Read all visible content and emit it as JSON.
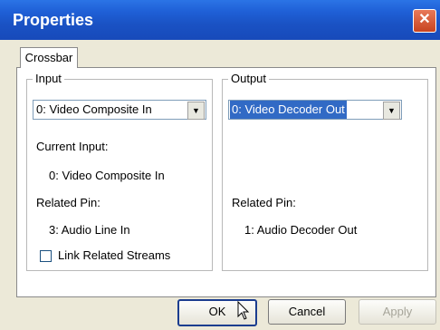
{
  "window": {
    "title": "Properties"
  },
  "tabs": [
    {
      "label": "Crossbar"
    }
  ],
  "input": {
    "group_label": "Input",
    "select_value": "0: Video Composite In",
    "current_input_label": "Current Input:",
    "current_input_value": "0: Video Composite In",
    "related_pin_label": "Related Pin:",
    "related_pin_value": "3: Audio Line In",
    "link_label": "Link Related Streams",
    "link_checked": false
  },
  "output": {
    "group_label": "Output",
    "select_value": "0: Video Decoder Out",
    "related_pin_label": "Related Pin:",
    "related_pin_value": "1: Audio Decoder Out"
  },
  "buttons": {
    "ok": "OK",
    "cancel": "Cancel",
    "apply": "Apply"
  },
  "icons": {
    "close": "close-icon",
    "dropdown": "chevron-down-icon",
    "cursor": "mouse-pointer-icon"
  }
}
